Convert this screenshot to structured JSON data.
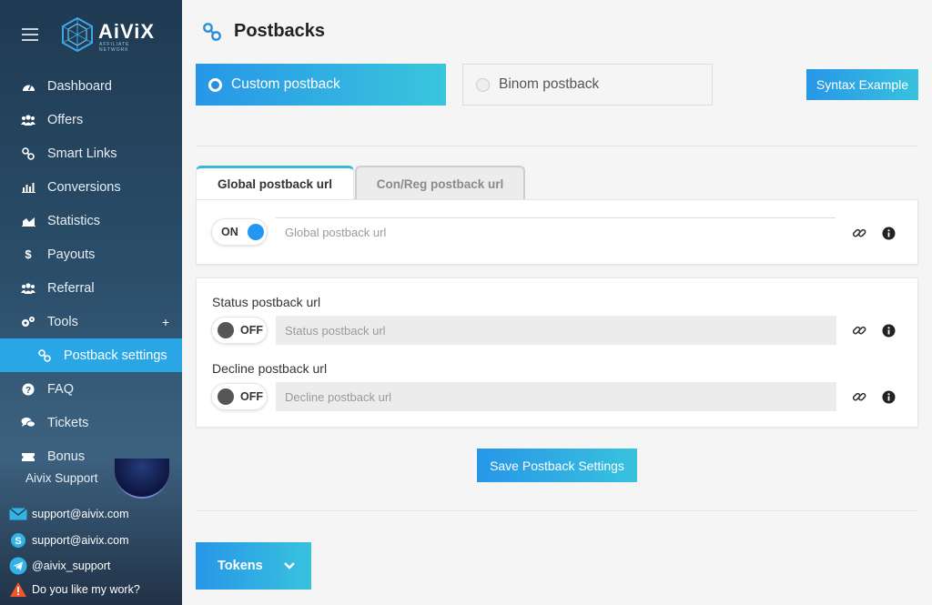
{
  "brand": {
    "name": "AiViX",
    "tagline": "AFFILIATE NETWORK"
  },
  "sidebar": {
    "items": [
      {
        "label": "Dashboard",
        "icon": "dashboard-icon"
      },
      {
        "label": "Offers",
        "icon": "users-icon"
      },
      {
        "label": "Smart Links",
        "icon": "link-icon"
      },
      {
        "label": "Conversions",
        "icon": "bar-chart-icon"
      },
      {
        "label": "Statistics",
        "icon": "area-chart-icon"
      },
      {
        "label": "Payouts",
        "icon": "dollar-icon"
      },
      {
        "label": "Referral",
        "icon": "users-icon"
      },
      {
        "label": "Tools",
        "icon": "gears-icon",
        "expand": "+"
      },
      {
        "label": "Postback settings",
        "icon": "link-icon",
        "active": true
      },
      {
        "label": "FAQ",
        "icon": "question-icon"
      },
      {
        "label": "Tickets",
        "icon": "comments-icon"
      },
      {
        "label": "Bonus",
        "icon": "ticket-icon"
      }
    ],
    "support": {
      "title": "Aivix Support",
      "email": "support@aivix.com",
      "skype": "support@aivix.com",
      "telegram": "@aivix_support",
      "feedback": "Do you like my work?"
    }
  },
  "main": {
    "title": "Postbacks",
    "postback_types": {
      "custom": "Custom postback",
      "binom": "Binom postback",
      "selected": "custom"
    },
    "syntax_button": "Syntax Example",
    "tabs": [
      {
        "label": "Global postback url",
        "active": true
      },
      {
        "label": "Con/Reg postback url",
        "active": false
      }
    ],
    "global": {
      "toggle": "ON",
      "placeholder": "Global postback url",
      "value": ""
    },
    "status": {
      "label": "Status postback url",
      "toggle": "OFF",
      "placeholder": "Status postback url"
    },
    "decline": {
      "label": "Decline postback url",
      "toggle": "OFF",
      "placeholder": "Decline postback url"
    },
    "save_button": "Save Postback Settings",
    "tokens_button": "Tokens"
  },
  "colors": {
    "accent": "#29a6e6",
    "gradient_start": "#2796e8",
    "gradient_end": "#38c2de",
    "sidebar": "#2a4e6a"
  }
}
